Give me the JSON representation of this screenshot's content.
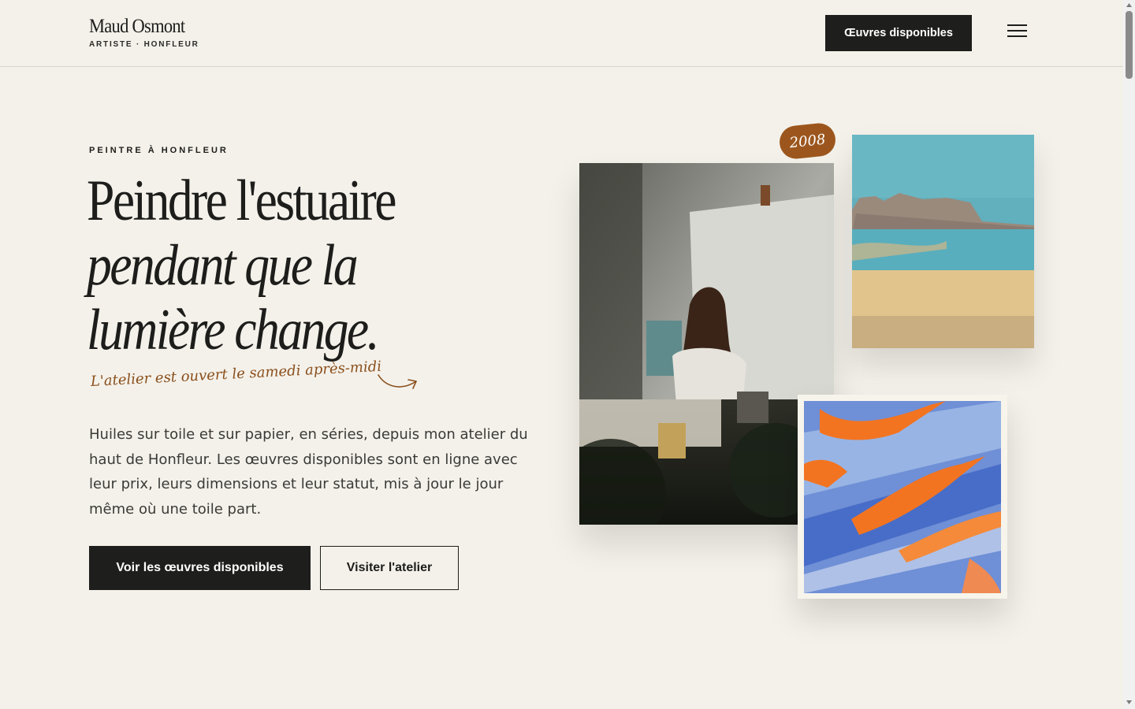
{
  "header": {
    "brand_name": "Maud Osmont",
    "brand_sub": "ARTISTE · HONFLEUR",
    "cta_label": "Œuvres disponibles"
  },
  "hero": {
    "eyebrow": "PEINTRE À HONFLEUR",
    "headline_line1": "Peindre l'estuaire",
    "headline_line2": "pendant que la",
    "headline_line3": "lumière change.",
    "handnote": "L'atelier est ouvert le samedi après-midi",
    "body": "Huiles sur toile et sur papier, en séries, depuis mon atelier du haut de Honfleur. Les œuvres disponibles sont en ligne avec leur prix, leurs dimensions et leur statut, mis à jour le jour même où une toile part.",
    "primary_button": "Voir les œuvres disponibles",
    "secondary_button": "Visiter l'atelier",
    "year_badge": "2008"
  },
  "colors": {
    "background": "#f4f1ea",
    "ink": "#1d1d1b",
    "accent": "#9c561d"
  },
  "icons": {
    "menu": "hamburger-menu-icon",
    "arrow": "curved-arrow-icon"
  }
}
